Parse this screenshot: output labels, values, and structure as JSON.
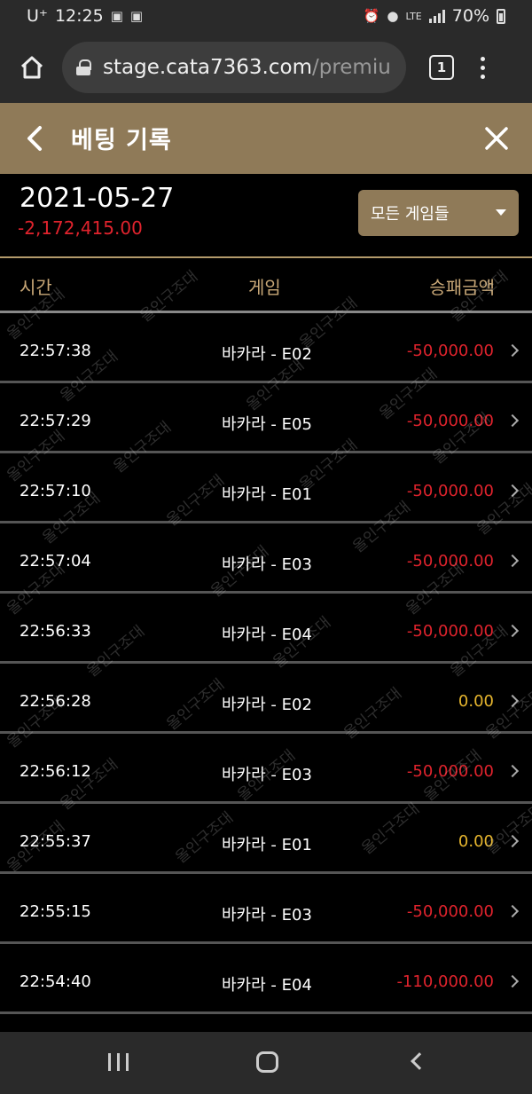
{
  "status_bar": {
    "carrier": "U⁺",
    "time": "12:25",
    "network": "LTE",
    "battery": "70%"
  },
  "browser": {
    "url_host": "stage.cata7363.com",
    "url_path": "/premiu",
    "tab_count": "1"
  },
  "header": {
    "title": "베팅 기록"
  },
  "summary": {
    "date": "2021-05-27",
    "total": "-2,172,415.00",
    "filter_label": "모든 게임들"
  },
  "table": {
    "columns": [
      "시간",
      "게임",
      "승패금액"
    ],
    "rows": [
      {
        "time": "22:57:38",
        "game": "바카라 - E02",
        "amount": "-50,000.00",
        "status": "negative"
      },
      {
        "time": "22:57:29",
        "game": "바카라 - E05",
        "amount": "-50,000.00",
        "status": "negative"
      },
      {
        "time": "22:57:10",
        "game": "바카라 - E01",
        "amount": "-50,000.00",
        "status": "negative"
      },
      {
        "time": "22:57:04",
        "game": "바카라 - E03",
        "amount": "-50,000.00",
        "status": "negative"
      },
      {
        "time": "22:56:33",
        "game": "바카라 - E04",
        "amount": "-50,000.00",
        "status": "negative"
      },
      {
        "time": "22:56:28",
        "game": "바카라 - E02",
        "amount": "0.00",
        "status": "zero"
      },
      {
        "time": "22:56:12",
        "game": "바카라 - E03",
        "amount": "-50,000.00",
        "status": "negative"
      },
      {
        "time": "22:55:37",
        "game": "바카라 - E01",
        "amount": "0.00",
        "status": "zero"
      },
      {
        "time": "22:55:15",
        "game": "바카라 - E03",
        "amount": "-50,000.00",
        "status": "negative"
      },
      {
        "time": "22:54:40",
        "game": "바카라 - E04",
        "amount": "-110,000.00",
        "status": "negative"
      }
    ]
  },
  "watermark_text": "올인구조대",
  "colors": {
    "header_bg": "#8f7a58",
    "accent_gold": "#c9a877",
    "negative": "#e0232d",
    "zero": "#e6b52e"
  },
  "icons": {
    "home": "home-icon",
    "lock": "lock-icon",
    "tabs": "tab-switcher-icon",
    "menu": "overflow-menu-icon",
    "back": "chevron-left-icon",
    "close": "close-icon",
    "dropdown": "caret-down-icon",
    "row": "chevron-right-icon"
  }
}
